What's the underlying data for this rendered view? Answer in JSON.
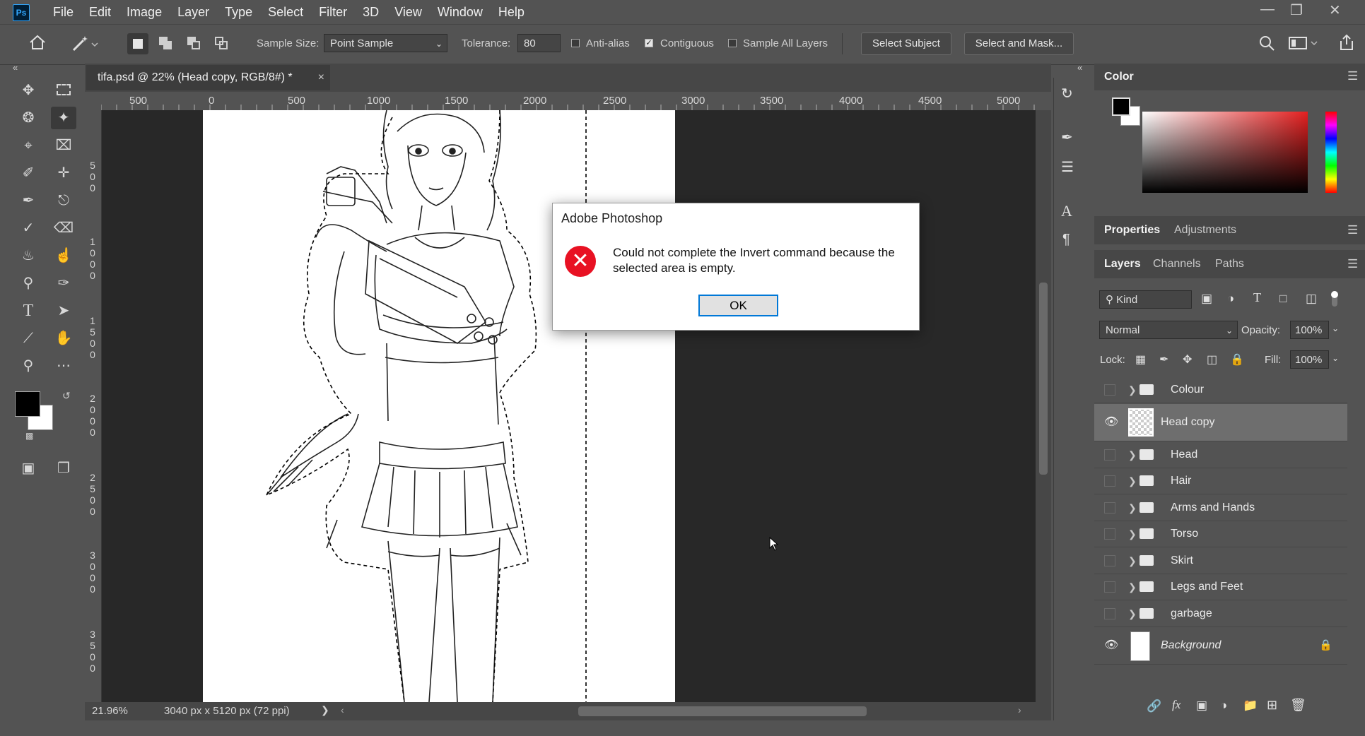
{
  "menubar": {
    "logo": "Ps",
    "items": [
      "File",
      "Edit",
      "Image",
      "Layer",
      "Type",
      "Select",
      "Filter",
      "3D",
      "View",
      "Window",
      "Help"
    ]
  },
  "options": {
    "sample_size_label": "Sample Size:",
    "sample_size_value": "Point Sample",
    "tolerance_label": "Tolerance:",
    "tolerance_value": "80",
    "anti_alias_label": "Anti-alias",
    "anti_alias_checked": false,
    "contiguous_label": "Contiguous",
    "contiguous_checked": true,
    "sample_all_layers_label": "Sample All Layers",
    "sample_all_layers_checked": false,
    "select_subject": "Select Subject",
    "select_and_mask": "Select and Mask..."
  },
  "document": {
    "tab_title": "tifa.psd @ 22% (Head copy, RGB/8#) *",
    "ruler_top": [
      "500",
      "0",
      "500",
      "1000",
      "1500",
      "2000",
      "2500",
      "3000",
      "3500",
      "4000",
      "4500",
      "5000"
    ],
    "ruler_left": [
      "5\n0\n0",
      "1\n0\n0\n0",
      "1\n5\n0\n0",
      "2\n0\n0\n0",
      "2\n5\n0\n0",
      "3\n0\n0\n0",
      "3\n5\n0\n0"
    ],
    "zoom": "21.96%",
    "dimensions": "3040 px x 5120 px (72 ppi)"
  },
  "dialog": {
    "title": "Adobe Photoshop",
    "message": "Could not complete the Invert command because the selected area is empty.",
    "ok": "OK",
    "icon": "error-icon"
  },
  "color_panel": {
    "title": "Color",
    "foreground": "#000000",
    "background": "#ffffff"
  },
  "properties_tabs": [
    "Properties",
    "Adjustments"
  ],
  "layers_panel": {
    "tabs": [
      "Layers",
      "Channels",
      "Paths"
    ],
    "filter_kind": "Kind",
    "blend_mode": "Normal",
    "opacity_label": "Opacity:",
    "opacity_value": "100%",
    "lock_label": "Lock:",
    "fill_label": "Fill:",
    "fill_value": "100%",
    "layers": [
      {
        "name": "Colour",
        "type": "group",
        "visible": false
      },
      {
        "name": "Head copy",
        "type": "layer",
        "visible": true,
        "selected": true
      },
      {
        "name": "Head",
        "type": "group",
        "visible": false
      },
      {
        "name": "Hair",
        "type": "group",
        "visible": false
      },
      {
        "name": "Arms and Hands",
        "type": "group",
        "visible": false
      },
      {
        "name": "Torso",
        "type": "group",
        "visible": false
      },
      {
        "name": "Skirt",
        "type": "group",
        "visible": false
      },
      {
        "name": "Legs and Feet",
        "type": "group",
        "visible": false
      },
      {
        "name": "garbage",
        "type": "group",
        "visible": false
      },
      {
        "name": "Background",
        "type": "background",
        "visible": true,
        "locked": true
      }
    ]
  }
}
